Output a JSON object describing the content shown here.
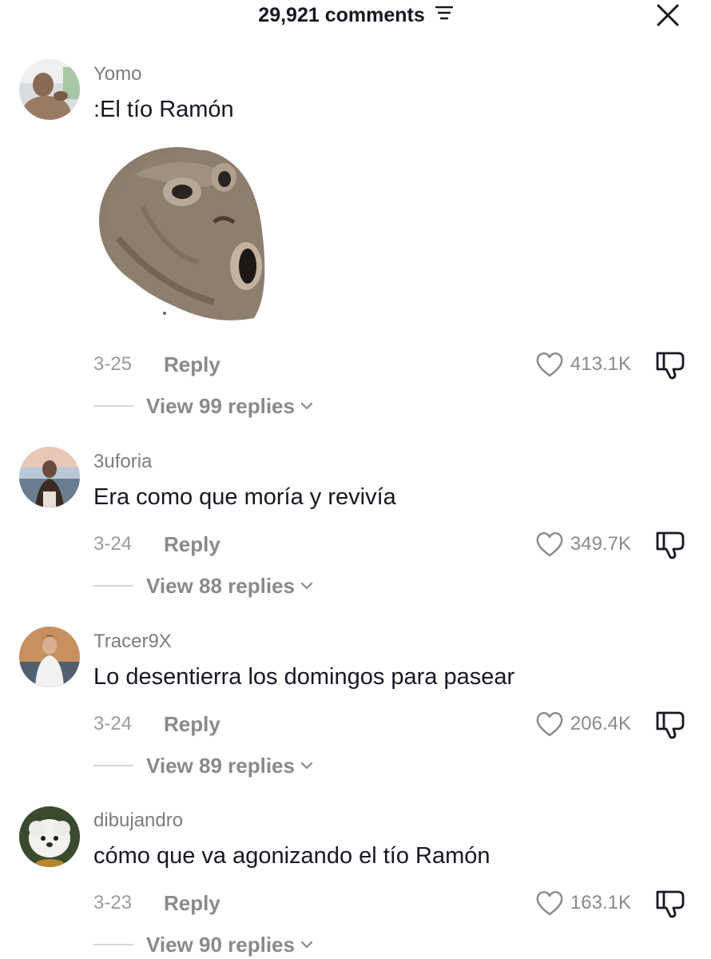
{
  "header": {
    "title": "29,921 comments",
    "filter_icon": "filter-icon",
    "close_icon": "close-icon"
  },
  "comments": [
    {
      "username": "Yomo",
      "text": ":El tío Ramón",
      "sticker": "skull-sticker",
      "date": "3-25",
      "reply_label": "Reply",
      "likes": "413.1K",
      "view_replies": "View 99 replies"
    },
    {
      "username": "3uforia",
      "text": "Era como que moría y revivía",
      "date": "3-24",
      "reply_label": "Reply",
      "likes": "349.7K",
      "view_replies": "View 88 replies"
    },
    {
      "username": "Tracer9X",
      "text": "Lo desentierra los domingos para pasear",
      "date": "3-24",
      "reply_label": "Reply",
      "likes": "206.4K",
      "view_replies": "View 89 replies"
    },
    {
      "username": "dibujandro",
      "text": "cómo que va agonizando el tío Ramón",
      "date": "3-23",
      "reply_label": "Reply",
      "likes": "163.1K",
      "view_replies": "View 90 replies"
    }
  ],
  "colors": {
    "text": "#161823",
    "muted": "#8a8a8a",
    "username": "#7d7d7d"
  }
}
